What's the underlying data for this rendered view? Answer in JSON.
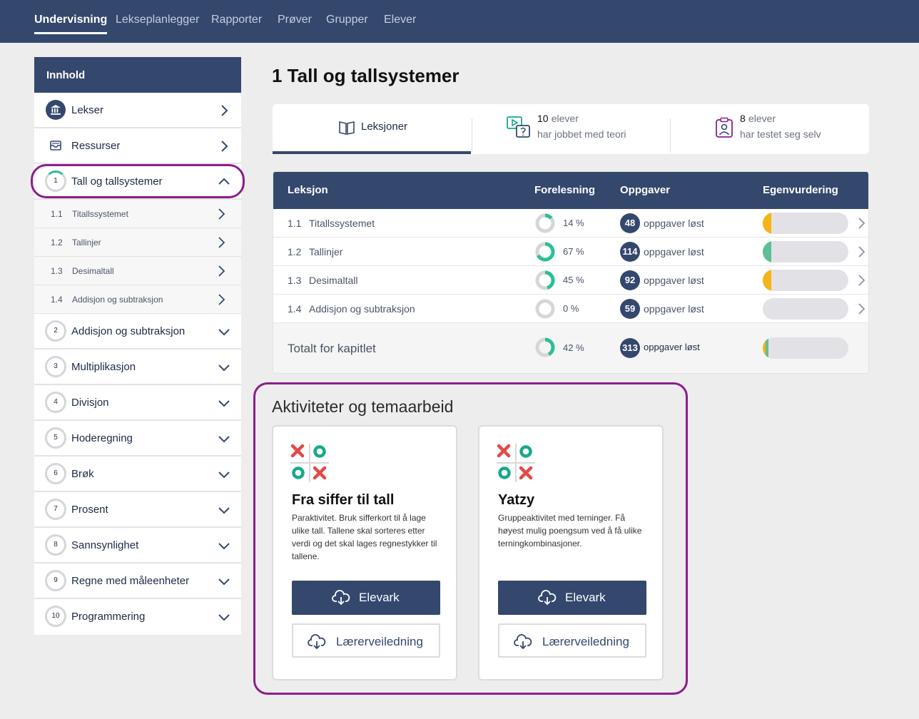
{
  "nav": {
    "items": [
      "Undervisning",
      "Lekseplanlegger",
      "Rapporter",
      "Prøver",
      "Grupper",
      "Elever"
    ],
    "active": "Undervisning"
  },
  "sidebar": {
    "header": "Innhold",
    "top_items": [
      {
        "label": "Lekser",
        "icon": "bank-icon"
      },
      {
        "label": "Ressurser",
        "icon": "inbox-icon"
      }
    ],
    "chapters": [
      {
        "num": "1",
        "label": "Tall og tallsystemer",
        "expanded": true
      },
      {
        "num": "2",
        "label": "Addisjon og subtraksjon"
      },
      {
        "num": "3",
        "label": "Multiplikasjon"
      },
      {
        "num": "4",
        "label": "Divisjon"
      },
      {
        "num": "5",
        "label": "Hoderegning"
      },
      {
        "num": "6",
        "label": "Brøk"
      },
      {
        "num": "7",
        "label": "Prosent"
      },
      {
        "num": "8",
        "label": "Sannsynlighet"
      },
      {
        "num": "9",
        "label": "Regne med måleenheter"
      },
      {
        "num": "10",
        "label": "Programmering"
      }
    ],
    "subitems": [
      {
        "num": "1.1",
        "label": "Titallssystemet"
      },
      {
        "num": "1.2",
        "label": "Tallinjer"
      },
      {
        "num": "1.3",
        "label": "Desimaltall"
      },
      {
        "num": "1.4",
        "label": "Addisjon og subtraksjon"
      }
    ]
  },
  "main": {
    "title": "1 Tall og tallsystemer",
    "tabs": {
      "lessons": "Leksjoner",
      "theory_count": "10",
      "theory_unit": "elever",
      "theory_sub": "har jobbet med teori",
      "test_count": "8",
      "test_unit": "elever",
      "test_sub": "har testet seg selv"
    },
    "table": {
      "headers": [
        "Leksjon",
        "Forelesning",
        "Oppgaver",
        "Egenvurdering"
      ],
      "rows": [
        {
          "num": "1.1",
          "name": "Titallssystemet",
          "lecture_pct": "14 %",
          "lecture_value": 14,
          "tasks": "48",
          "tasks_label": "oppgaver løst",
          "self_color": "#f5b418",
          "self_fill": 0.1
        },
        {
          "num": "1.2",
          "name": "Tallinjer",
          "lecture_pct": "67 %",
          "lecture_value": 67,
          "tasks": "114",
          "tasks_label": "oppgaver løst",
          "self_color": "#5fbf97",
          "self_fill": 0.1
        },
        {
          "num": "1.3",
          "name": "Desimaltall",
          "lecture_pct": "45 %",
          "lecture_value": 45,
          "tasks": "92",
          "tasks_label": "oppgaver løst",
          "self_color": "#f5b418",
          "self_fill": 0.1
        },
        {
          "num": "1.4",
          "name": "Addisjon og subtraksjon",
          "lecture_pct": "0 %",
          "lecture_value": 0,
          "tasks": "59",
          "tasks_label": "oppgaver løst",
          "self_color": "#e2e2e6",
          "self_fill": 0
        }
      ],
      "total": {
        "label": "Totalt for kapitlet",
        "lecture_pct": "42 %",
        "lecture_value": 42,
        "tasks": "313",
        "tasks_label": "oppgaver løst"
      }
    },
    "activities": {
      "title": "Aktiviteter og temaarbeid",
      "cards": [
        {
          "title": "Fra siffer til tall",
          "desc": "Paraktivitet. Bruk sifferkort til å lage ulike tall. Tallene skal sorteres etter verdi og det skal lages regnestykker til tallene.",
          "primary": "Elevark",
          "secondary": "Lærerveiledning"
        },
        {
          "title": "Yatzy",
          "desc": "Gruppeaktivitet med terninger. Få høyest mulig poengsum ved å få ulike terningkombinasjoner.",
          "primary": "Elevark",
          "secondary": "Lærerveiledning"
        }
      ]
    }
  },
  "colors": {
    "navy": "#34486e",
    "green": "#2bbf95",
    "yellow": "#f5b418",
    "highlight": "#8c1e8a",
    "red": "#e24a4a",
    "teal": "#16a98a"
  }
}
